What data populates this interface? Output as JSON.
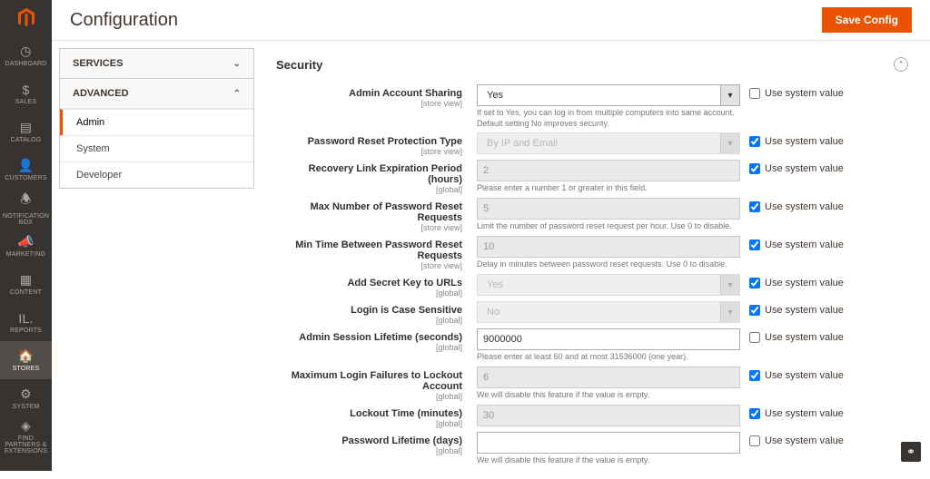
{
  "page": {
    "title": "Configuration",
    "save_btn": "Save Config"
  },
  "nav": {
    "items": [
      {
        "label": "DASHBOARD",
        "icon": "◷"
      },
      {
        "label": "SALES",
        "icon": "$"
      },
      {
        "label": "CATALOG",
        "icon": "▤"
      },
      {
        "label": "CUSTOMERS",
        "icon": "👤"
      },
      {
        "label": "NOTIFICATION BOX",
        "icon": "🕭"
      },
      {
        "label": "MARKETING",
        "icon": "📣"
      },
      {
        "label": "CONTENT",
        "icon": "▦"
      },
      {
        "label": "REPORTS",
        "icon": "ıl."
      },
      {
        "label": "STORES",
        "icon": "🏠"
      },
      {
        "label": "SYSTEM",
        "icon": "⚙"
      },
      {
        "label": "FIND PARTNERS & EXTENSIONS",
        "icon": "◈"
      }
    ]
  },
  "tabs": {
    "services": "SERVICES",
    "advanced": "ADVANCED",
    "items": [
      {
        "label": "Admin"
      },
      {
        "label": "System"
      },
      {
        "label": "Developer"
      }
    ]
  },
  "section": {
    "title": "Security",
    "use_system_label": "Use system value",
    "fields": [
      {
        "label": "Admin Account Sharing",
        "scope": "[store view]",
        "value": "Yes",
        "type": "select",
        "disabled": false,
        "use_sys": false,
        "note": "If set to Yes, you can log in from multiple computers into same account. Default setting No improves security."
      },
      {
        "label": "Password Reset Protection Type",
        "scope": "[store view]",
        "value": "By IP and Email",
        "type": "select",
        "disabled": true,
        "use_sys": true,
        "note": ""
      },
      {
        "label": "Recovery Link Expiration Period (hours)",
        "scope": "[global]",
        "value": "2",
        "type": "text",
        "disabled": true,
        "use_sys": true,
        "note": "Please enter a number 1 or greater in this field."
      },
      {
        "label": "Max Number of Password Reset Requests",
        "scope": "[store view]",
        "value": "5",
        "type": "text",
        "disabled": true,
        "use_sys": true,
        "note": "Limit the number of password reset request per hour. Use 0 to disable."
      },
      {
        "label": "Min Time Between Password Reset Requests",
        "scope": "[store view]",
        "value": "10",
        "type": "text",
        "disabled": true,
        "use_sys": true,
        "note": "Delay in minutes between password reset requests. Use 0 to disable."
      },
      {
        "label": "Add Secret Key to URLs",
        "scope": "[global]",
        "value": "Yes",
        "type": "select",
        "disabled": true,
        "use_sys": true,
        "note": ""
      },
      {
        "label": "Login is Case Sensitive",
        "scope": "[global]",
        "value": "No",
        "type": "select",
        "disabled": true,
        "use_sys": true,
        "note": ""
      },
      {
        "label": "Admin Session Lifetime (seconds)",
        "scope": "[global]",
        "value": "9000000",
        "type": "text",
        "disabled": false,
        "use_sys": false,
        "note": "Please enter at least 60 and at most 31536000 (one year)."
      },
      {
        "label": "Maximum Login Failures to Lockout Account",
        "scope": "[global]",
        "value": "6",
        "type": "text",
        "disabled": true,
        "use_sys": true,
        "note": "We will disable this feature if the value is empty."
      },
      {
        "label": "Lockout Time (minutes)",
        "scope": "[global]",
        "value": "30",
        "type": "text",
        "disabled": true,
        "use_sys": true,
        "note": ""
      },
      {
        "label": "Password Lifetime (days)",
        "scope": "[global]",
        "value": "",
        "type": "text",
        "disabled": false,
        "use_sys": false,
        "note": "We will disable this feature if the value is empty."
      }
    ]
  }
}
